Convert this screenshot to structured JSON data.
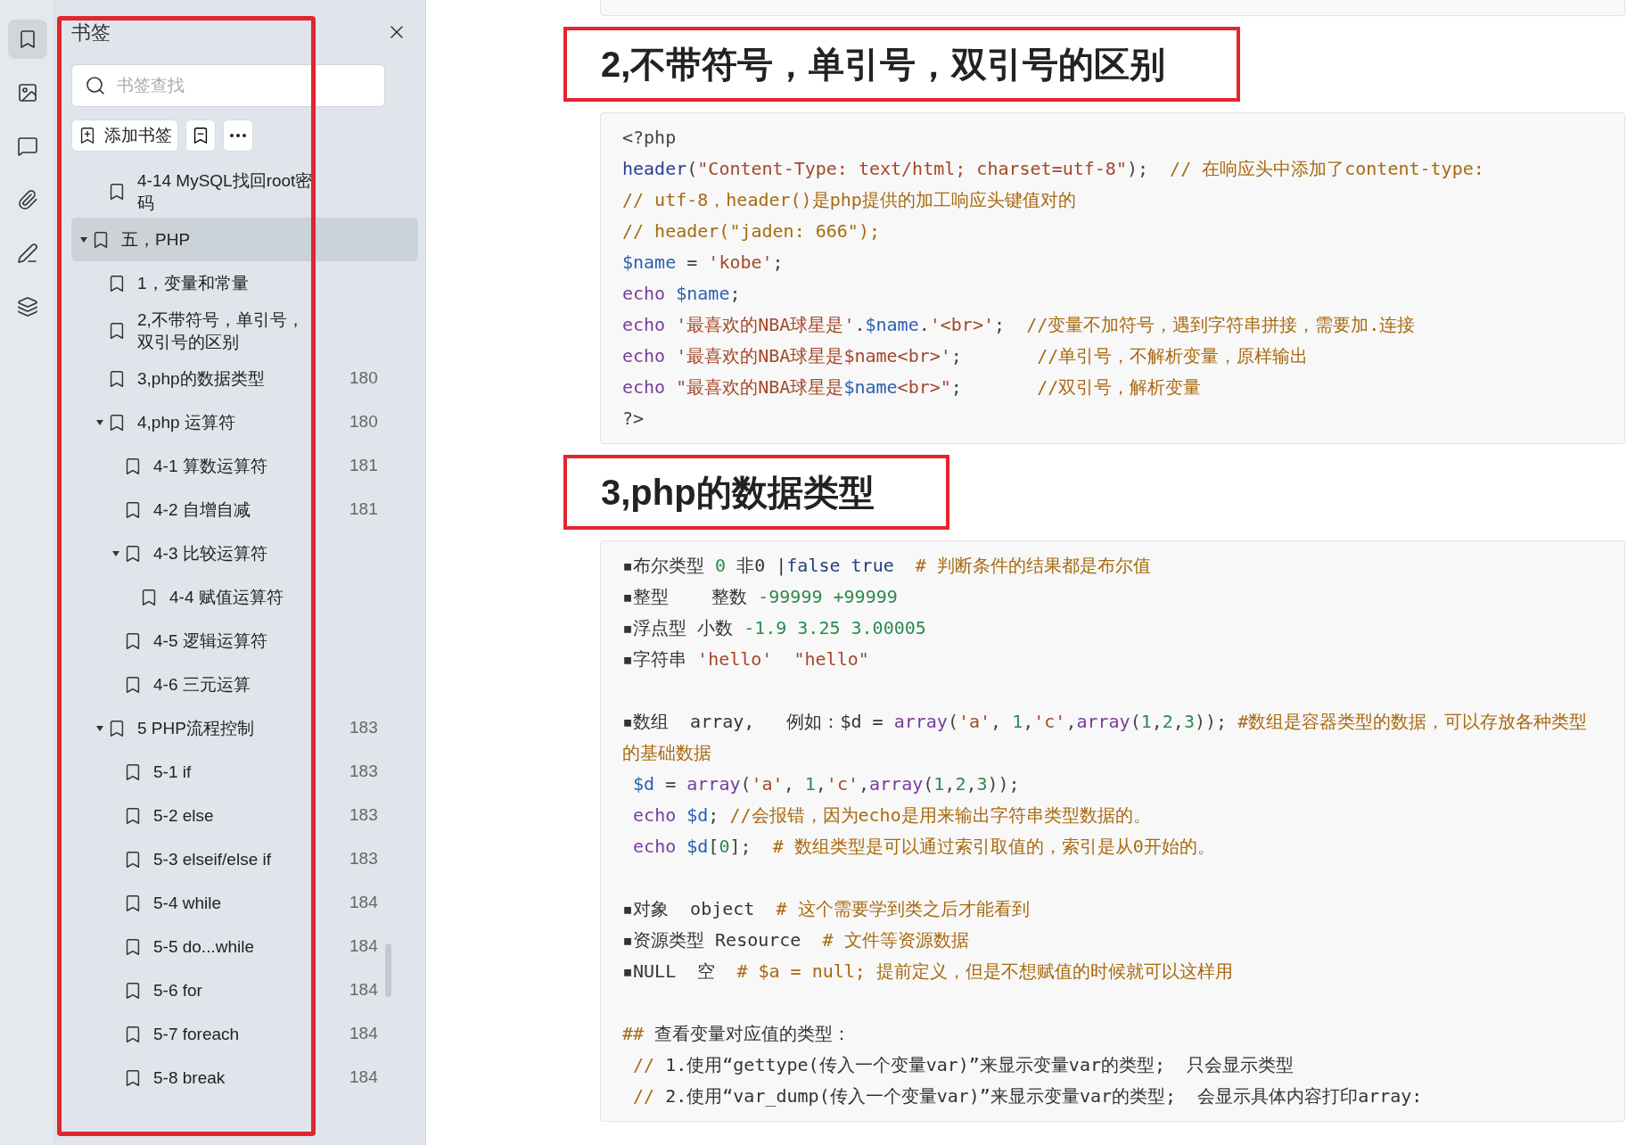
{
  "rail": [
    {
      "kind": "bookmark",
      "selected": true
    },
    {
      "kind": "image",
      "selected": false
    },
    {
      "kind": "comment",
      "selected": false
    },
    {
      "kind": "attachment",
      "selected": false
    },
    {
      "kind": "sign",
      "selected": false
    },
    {
      "kind": "layers",
      "selected": false
    }
  ],
  "sidebar": {
    "title": "书签",
    "search": {
      "placeholder": "书签查找"
    },
    "add_button": "添加书签",
    "bookmarks": [
      {
        "kind": "hidden-parent",
        "children": [
          {
            "label": "4-14 MySQL找回root密码",
            "selected": false
          }
        ]
      },
      {
        "label": "五，PHP",
        "selected": true,
        "expanded": true,
        "children": [
          {
            "label": "1，变量和常量",
            "selected": false
          },
          {
            "label": "2,不带符号，单引号，双引号的区别",
            "selected": false
          },
          {
            "label": "3,php的数据类型",
            "page": "180",
            "selected": false
          },
          {
            "label": "4,php 运算符",
            "page": "180",
            "selected": false,
            "expanded": true,
            "children": [
              {
                "label": "4-1 算数运算符",
                "page": "181",
                "selected": false
              },
              {
                "label": "4-2 自增自减",
                "page": "181",
                "selected": false
              },
              {
                "label": "4-3 比较运算符",
                "selected": false,
                "expanded": true,
                "children": [
                  {
                    "label": "4-4 赋值运算符",
                    "selected": false
                  }
                ]
              },
              {
                "label": "4-5 逻辑运算符",
                "selected": false
              },
              {
                "label": "4-6 三元运算",
                "selected": false
              }
            ]
          },
          {
            "label": "5 PHP流程控制",
            "page": "183",
            "selected": false,
            "expanded": true,
            "children": [
              {
                "label": "5-1 if",
                "page": "183",
                "selected": false
              },
              {
                "label": "5-2 else",
                "page": "183",
                "selected": false
              },
              {
                "label": "5-3 elseif/else if",
                "page": "183",
                "selected": false
              },
              {
                "label": "5-4 while",
                "page": "184",
                "selected": false
              },
              {
                "label": "5-5 do...while",
                "page": "184",
                "selected": false
              },
              {
                "label": "5-6 for",
                "page": "184",
                "selected": false
              },
              {
                "label": "5-7 foreach",
                "page": "184",
                "selected": false
              },
              {
                "label": "5-8 break",
                "page": "184",
                "selected": false
              }
            ]
          }
        ]
      }
    ]
  },
  "document": [
    {
      "kind": "code-edge"
    },
    {
      "kind": "heading",
      "text": "2,不带符号，单引号，双引号的区别"
    },
    {
      "kind": "code",
      "lines": [
        {
          "kind": "code",
          "segments": [
            {
              "kind": "op",
              "text": "<?php"
            }
          ]
        },
        {
          "kind": "code",
          "segments": [
            {
              "kind": "func",
              "text": "header"
            },
            {
              "kind": "op",
              "text": "("
            },
            {
              "kind": "string",
              "text": "\"Content-Type: text/html; charset=utf-8\""
            },
            {
              "kind": "op",
              "text": ");  "
            },
            {
              "kind": "comment",
              "text": "// 在响应头中添加了content-type:"
            }
          ]
        },
        {
          "kind": "code",
          "segments": [
            {
              "kind": "comment",
              "text": "// utf-8，header()是php提供的加工响应头键值对的"
            }
          ]
        },
        {
          "kind": "code",
          "segments": [
            {
              "kind": "comment",
              "text": "// header(\"jaden: 666\");"
            }
          ]
        },
        {
          "kind": "code",
          "segments": [
            {
              "kind": "var",
              "text": "$name"
            },
            {
              "kind": "op",
              "text": " = "
            },
            {
              "kind": "string",
              "text": "'kobe'"
            },
            {
              "kind": "op",
              "text": ";"
            }
          ]
        },
        {
          "kind": "code",
          "segments": [
            {
              "kind": "keyword",
              "text": "echo "
            },
            {
              "kind": "var",
              "text": "$name"
            },
            {
              "kind": "op",
              "text": ";"
            }
          ]
        },
        {
          "kind": "code",
          "segments": [
            {
              "kind": "keyword",
              "text": "echo "
            },
            {
              "kind": "string",
              "text": "'最喜欢的NBA球星是'"
            },
            {
              "kind": "op",
              "text": "."
            },
            {
              "kind": "var",
              "text": "$name"
            },
            {
              "kind": "op",
              "text": "."
            },
            {
              "kind": "string",
              "text": "'<br>'"
            },
            {
              "kind": "op",
              "text": ";  "
            },
            {
              "kind": "comment",
              "text": "//变量不加符号，遇到字符串拼接，需要加.连接"
            }
          ]
        },
        {
          "kind": "code",
          "segments": [
            {
              "kind": "keyword",
              "text": "echo "
            },
            {
              "kind": "string",
              "text": "'最喜欢的NBA球星是$name<br>'"
            },
            {
              "kind": "op",
              "text": ";       "
            },
            {
              "kind": "comment",
              "text": "//单引号，不解析变量，原样输出"
            }
          ]
        },
        {
          "kind": "code",
          "segments": [
            {
              "kind": "keyword",
              "text": "echo "
            },
            {
              "kind": "string",
              "text": "\"最喜欢的NBA球星是"
            },
            {
              "kind": "var",
              "text": "$name"
            },
            {
              "kind": "string",
              "text": "<br>\""
            },
            {
              "kind": "op",
              "text": ";       "
            },
            {
              "kind": "comment",
              "text": "//双引号，解析变量"
            }
          ]
        },
        {
          "kind": "code",
          "segments": [
            {
              "kind": "op",
              "text": "?>"
            }
          ]
        }
      ]
    },
    {
      "kind": "heading",
      "text": "3,php的数据类型"
    },
    {
      "kind": "code",
      "lines": [
        {
          "kind": "code",
          "segments": [
            {
              "kind": "plain",
              "text": "▪布尔类型 "
            },
            {
              "kind": "number",
              "text": "0"
            },
            {
              "kind": "plain",
              "text": " 非0 |"
            },
            {
              "kind": "const",
              "text": "false true"
            },
            {
              "kind": "comment",
              "text": "  # 判断条件的结果都是布尔值"
            }
          ]
        },
        {
          "kind": "code",
          "segments": [
            {
              "kind": "plain",
              "text": "▪整型    整数 "
            },
            {
              "kind": "number",
              "text": "-99999 +99999"
            }
          ]
        },
        {
          "kind": "code",
          "segments": [
            {
              "kind": "plain",
              "text": "▪浮点型 小数 "
            },
            {
              "kind": "number",
              "text": "-1.9 3.25 3.00005"
            }
          ]
        },
        {
          "kind": "code",
          "segments": [
            {
              "kind": "plain",
              "text": "▪字符串 "
            },
            {
              "kind": "string",
              "text": "'hello'  \"hello\""
            }
          ]
        },
        {
          "kind": "blank"
        },
        {
          "kind": "code",
          "segments": [
            {
              "kind": "plain",
              "text": "▪数组  array,   例如：$d = "
            },
            {
              "kind": "keyword",
              "text": "array"
            },
            {
              "kind": "op",
              "text": "("
            },
            {
              "kind": "string",
              "text": "'a'"
            },
            {
              "kind": "op",
              "text": ", "
            },
            {
              "kind": "number",
              "text": "1"
            },
            {
              "kind": "op",
              "text": ","
            },
            {
              "kind": "string",
              "text": "'c'"
            },
            {
              "kind": "op",
              "text": ","
            },
            {
              "kind": "keyword",
              "text": "array"
            },
            {
              "kind": "op",
              "text": "("
            },
            {
              "kind": "number",
              "text": "1"
            },
            {
              "kind": "op",
              "text": ","
            },
            {
              "kind": "number",
              "text": "2"
            },
            {
              "kind": "op",
              "text": ","
            },
            {
              "kind": "number",
              "text": "3"
            },
            {
              "kind": "op",
              "text": ")); "
            },
            {
              "kind": "comment",
              "text": "#数组是容器类型的数据，可以存放各种类型的基础数据"
            }
          ]
        },
        {
          "kind": "code",
          "segments": [
            {
              "kind": "var",
              "text": " $d"
            },
            {
              "kind": "op",
              "text": " = "
            },
            {
              "kind": "keyword",
              "text": "array"
            },
            {
              "kind": "op",
              "text": "("
            },
            {
              "kind": "string",
              "text": "'a'"
            },
            {
              "kind": "op",
              "text": ", "
            },
            {
              "kind": "number",
              "text": "1"
            },
            {
              "kind": "op",
              "text": ","
            },
            {
              "kind": "string",
              "text": "'c'"
            },
            {
              "kind": "op",
              "text": ","
            },
            {
              "kind": "keyword",
              "text": "array"
            },
            {
              "kind": "op",
              "text": "("
            },
            {
              "kind": "number",
              "text": "1"
            },
            {
              "kind": "op",
              "text": ","
            },
            {
              "kind": "number",
              "text": "2"
            },
            {
              "kind": "op",
              "text": ","
            },
            {
              "kind": "number",
              "text": "3"
            },
            {
              "kind": "op",
              "text": "));"
            }
          ]
        },
        {
          "kind": "code",
          "segments": [
            {
              "kind": "keyword",
              "text": " echo "
            },
            {
              "kind": "var",
              "text": "$d"
            },
            {
              "kind": "op",
              "text": "; "
            },
            {
              "kind": "comment",
              "text": "//会报错，因为echo是用来输出字符串类型数据的。"
            }
          ]
        },
        {
          "kind": "code",
          "segments": [
            {
              "kind": "keyword",
              "text": " echo "
            },
            {
              "kind": "var",
              "text": "$d"
            },
            {
              "kind": "op",
              "text": "["
            },
            {
              "kind": "number",
              "text": "0"
            },
            {
              "kind": "op",
              "text": "];  "
            },
            {
              "kind": "comment",
              "text": "# 数组类型是可以通过索引取值的，索引是从0开始的。"
            }
          ]
        },
        {
          "kind": "blank"
        },
        {
          "kind": "code",
          "segments": [
            {
              "kind": "plain",
              "text": "▪对象  object  "
            },
            {
              "kind": "comment",
              "text": "# 这个需要学到类之后才能看到"
            }
          ]
        },
        {
          "kind": "code",
          "segments": [
            {
              "kind": "plain",
              "text": "▪资源类型 Resource  "
            },
            {
              "kind": "comment",
              "text": "# 文件等资源数据"
            }
          ]
        },
        {
          "kind": "code",
          "segments": [
            {
              "kind": "plain",
              "text": "▪NULL  空  "
            },
            {
              "kind": "comment",
              "text": "# $a = null; 提前定义，但是不想赋值的时候就可以这样用"
            }
          ]
        },
        {
          "kind": "blank"
        },
        {
          "kind": "code",
          "segments": [
            {
              "kind": "comment",
              "text": "##"
            },
            {
              "kind": "plain",
              "text": " 查看变量对应值的类型："
            }
          ]
        },
        {
          "kind": "code",
          "segments": [
            {
              "kind": "comment",
              "text": " //"
            },
            {
              "kind": "plain",
              "text": " 1.使用“gettype(传入一个变量var)”来显示变量var的类型;  只会显示类型"
            }
          ]
        },
        {
          "kind": "code",
          "segments": [
            {
              "kind": "comment",
              "text": " //"
            },
            {
              "kind": "plain",
              "text": " 2.使用“var_dump(传入一个变量var)”来显示变量var的类型;  会显示具体内容打印array:"
            }
          ]
        }
      ]
    }
  ]
}
